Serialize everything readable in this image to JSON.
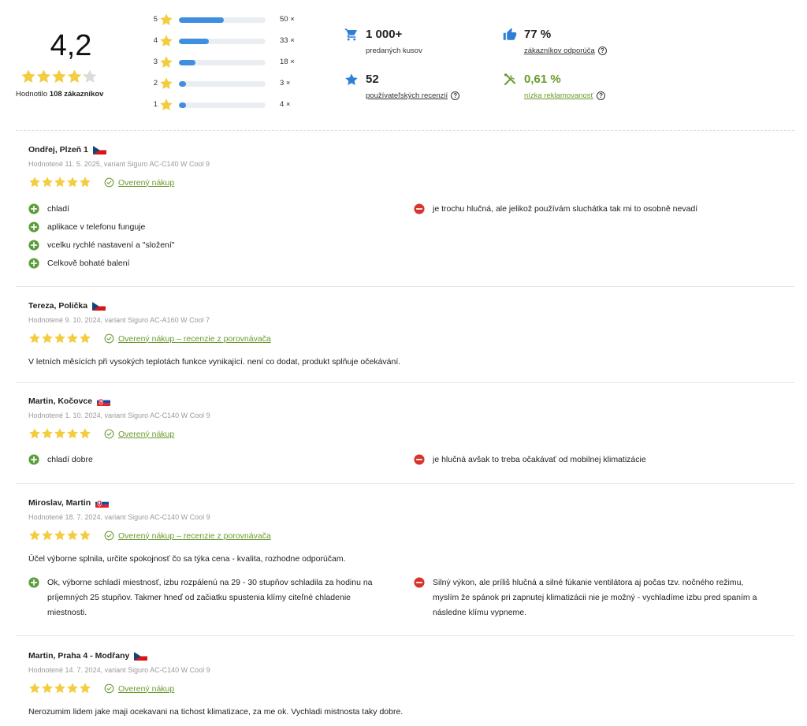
{
  "summary": {
    "average": "4,2",
    "average_stars": 4.2,
    "caption_prefix": "Hodnotilo",
    "caption_bold": "108 zákazníkov",
    "distribution": [
      {
        "stars": "5",
        "count": "50 ×",
        "value": 50
      },
      {
        "stars": "4",
        "count": "33 ×",
        "value": 33
      },
      {
        "stars": "3",
        "count": "18 ×",
        "value": 18
      },
      {
        "stars": "2",
        "count": "3 ×",
        "value": 3
      },
      {
        "stars": "1",
        "count": "4 ×",
        "value": 4
      }
    ],
    "stats": {
      "sold_value": "1 000+",
      "sold_label": "predaných kusov",
      "recommend_value": "77 %",
      "recommend_label": "zákazníkov odporúča",
      "reviews_value": "52",
      "reviews_label": "používateľských recenzií",
      "complaints_value": "0,61 %",
      "complaints_label": "nízka reklamovanosť"
    }
  },
  "colors": {
    "star": "#f3cd3f",
    "star_empty": "#dcdcdc",
    "bar": "#3f8ee0",
    "green": "#6a9a2c",
    "pro": "#5a9e3a",
    "con": "#d9342b",
    "blue_icon": "#2f7fd6"
  },
  "reviews": [
    {
      "author": "Ondřej, Plzeň 1",
      "flag": "cz",
      "meta": "Hodnotené 11. 5. 2025, variant Siguro AC-C140 W Cool 9",
      "verified": "Overený nákup",
      "pros": [
        "chladí",
        "aplikace v telefonu funguje",
        "vcelku rychlé nastavení a \"složení\"",
        "Celkově bohaté balení"
      ],
      "cons": [
        "je trochu hlučná, ale jelikož používám sluchátka tak mi to osobně nevadí"
      ]
    },
    {
      "author": "Tereza, Polička",
      "flag": "cz",
      "meta": "Hodnotené 9. 10. 2024, variant Siguro AC-A160 W Cool 7",
      "verified": "Overený nákup – recenzie z porovnávača",
      "text": "V letních měsících při vysokých teplotách funkce vynikající. není co dodat, produkt splňuje očekávání."
    },
    {
      "author": "Martin, Kočovce",
      "flag": "sk",
      "meta": "Hodnotené 1. 10. 2024, variant Siguro AC-C140 W Cool 9",
      "verified": "Overený nákup",
      "pros": [
        "chladí dobre"
      ],
      "cons": [
        "je hlučná avšak to treba očakávať od mobilnej klimatizácie"
      ]
    },
    {
      "author": "Miroslav, Martin",
      "flag": "sk",
      "meta": "Hodnotené 18. 7. 2024, variant Siguro AC-C140 W Cool 9",
      "verified": "Overený nákup – recenzie z porovnávača",
      "text": "Účel výborne splnila, určite spokojnosť čo sa týka cena - kvalita, rozhodne odporúčam.",
      "pro_lines": [
        "Ok, výborne schladí miestnosť, izbu rozpálenú na 29 - 30 stupňov schladila za hodinu na",
        "príjemných 25 stupňov. Takmer hneď od začiatku spustenia klímy citeľné chladenie",
        "miestnosti."
      ],
      "con_lines": [
        "Silný výkon, ale príliš hlučná a silné fúkanie ventilátora aj počas tzv. nočného režimu,",
        "myslím že spánok pri zapnutej klimatizácii nie je možný - vychladíme izbu pred spaním a",
        "následne klímu vypneme."
      ]
    },
    {
      "author": "Martin, Praha 4 - Modřany",
      "flag": "cz",
      "meta": "Hodnotené 14. 7. 2024, variant Siguro AC-C140 W Cool 9",
      "verified": "Overený nákup",
      "text": "Nerozumim lidem jake maji ocekavani na tichost klimatizace, za me ok. Vychladi mistnosta taky dobre."
    }
  ]
}
